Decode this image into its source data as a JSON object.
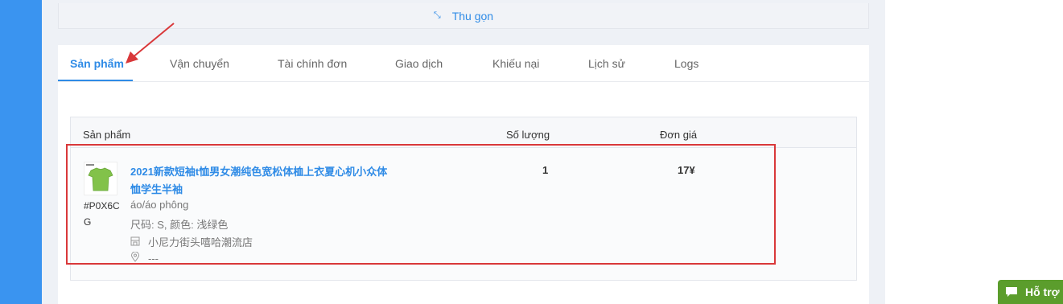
{
  "collapse": {
    "label": "Thu gọn",
    "icon": "collapse-arrows-icon"
  },
  "tabs": [
    {
      "label": "Sản phẩm",
      "active": true
    },
    {
      "label": "Vận chuyển"
    },
    {
      "label": "Tài chính đơn"
    },
    {
      "label": "Giao dịch"
    },
    {
      "label": "Khiếu nại"
    },
    {
      "label": "Lịch sử"
    },
    {
      "label": "Logs"
    }
  ],
  "table": {
    "headers": {
      "product": "Sản phẩm",
      "quantity": "Số lượng",
      "unit_price": "Đơn giá"
    },
    "rows": [
      {
        "code": "#P0X6CG",
        "name": "2021新款短袖t恤男女潮纯色宽松体桖上衣夏心机小众体恤学生半袖",
        "category": "áo/áo phông",
        "attributes": "尺码: S, 颜色: 浅绿色",
        "shop": "小尼力街头嘻哈潮流店",
        "location": "---",
        "quantity": "1",
        "price": "17¥"
      }
    ]
  },
  "support": {
    "label": "Hỗ trợ",
    "icon": "chat-bubble-icon"
  },
  "colors": {
    "accent": "#2f8be6",
    "sidebar": "#3a94f0",
    "highlight": "#d9383a",
    "support": "#5b9d2c"
  }
}
